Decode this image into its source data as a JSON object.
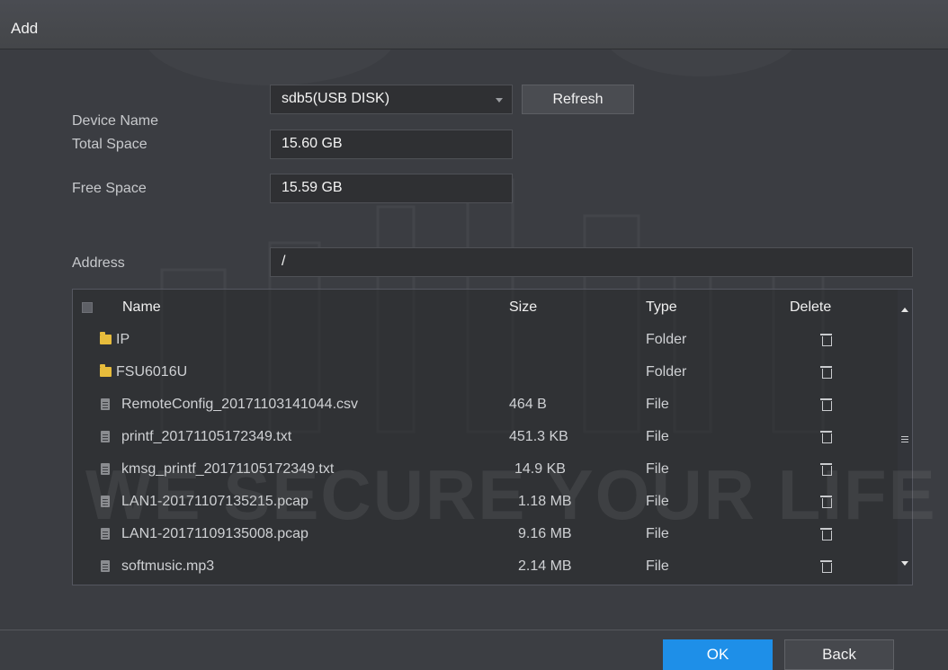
{
  "window": {
    "title": "Add"
  },
  "form": {
    "device_name_label": "Device Name",
    "device_name_value": "sdb5(USB DISK)",
    "refresh_label": "Refresh",
    "total_space_label": "Total Space",
    "total_space_value": "15.60 GB",
    "free_space_label": "Free Space",
    "free_space_value": "15.59 GB",
    "address_label": "Address",
    "address_value": "/"
  },
  "table": {
    "columns": {
      "name": "Name",
      "size": "Size",
      "type": "Type",
      "delete": "Delete"
    },
    "rows": [
      {
        "icon": "folder-icon",
        "name": "IP",
        "size": "",
        "type": "Folder"
      },
      {
        "icon": "folder-icon",
        "name": "FSU6016U",
        "size": "",
        "type": "Folder"
      },
      {
        "icon": "file-icon",
        "name": "RemoteConfig_20171103141044.csv",
        "size": "464 B",
        "type": "File"
      },
      {
        "icon": "file-icon",
        "name": "printf_20171105172349.txt",
        "size": "451.3 KB",
        "type": "File"
      },
      {
        "icon": "file-icon",
        "name": "kmsg_printf_20171105172349.txt",
        "size": "14.9 KB",
        "type": "File"
      },
      {
        "icon": "file-icon",
        "name": "LAN1-20171107135215.pcap",
        "size": "1.18 MB",
        "type": "File"
      },
      {
        "icon": "file-icon",
        "name": "LAN1-20171109135008.pcap",
        "size": "9.16 MB",
        "type": "File"
      },
      {
        "icon": "file-icon",
        "name": "softmusic.mp3",
        "size": "2.14 MB",
        "type": "File"
      }
    ]
  },
  "footer": {
    "ok_label": "OK",
    "back_label": "Back"
  },
  "watermark": {
    "text": "WE SECURE YOUR LIFE"
  },
  "colors": {
    "accent": "#1e8fe8",
    "folder": "#e7bc3c",
    "background": "#3b3d42"
  }
}
